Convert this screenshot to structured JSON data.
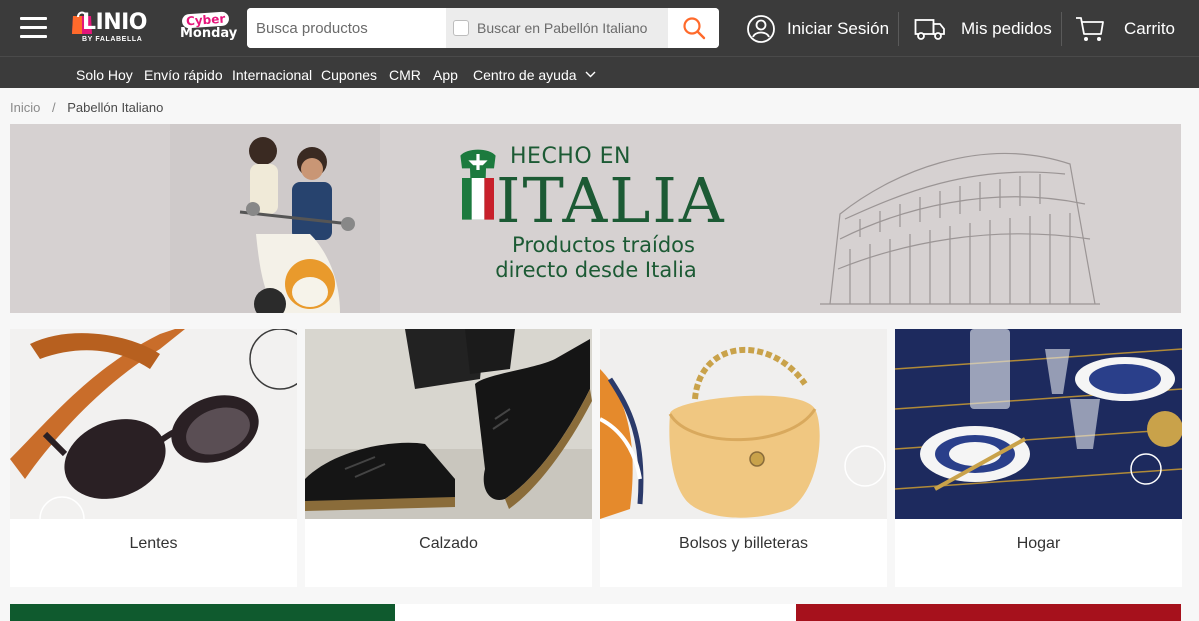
{
  "header": {
    "logo_text": "LINIO",
    "logo_subtext": "BY FALABELLA",
    "promo_line1": "Cyber",
    "promo_line2": "Monday",
    "search_placeholder": "Busca productos",
    "search_scope_label": "Buscar en Pabellón Italiano",
    "login_label": "Iniciar Sesión",
    "orders_label": "Mis pedidos",
    "cart_label": "Carrito"
  },
  "nav": {
    "items": [
      "Solo Hoy",
      "Envío rápido",
      "Internacional",
      "Cupones",
      "CMR",
      "App",
      "Centro de ayuda"
    ]
  },
  "breadcrumb": {
    "home": "Inicio",
    "separator": "/",
    "current": "Pabellón Italiano"
  },
  "banner": {
    "line1": "HECHO EN",
    "line2": "ITALIA",
    "line3": "Productos traídos",
    "line4": "directo desde Italia"
  },
  "categories": [
    {
      "label": "Lentes"
    },
    {
      "label": "Calzado"
    },
    {
      "label": "Bolsos y billeteras"
    },
    {
      "label": "Hogar"
    }
  ],
  "colors": {
    "header_bg": "#3b3b3b",
    "search_accent": "#ff6a2b",
    "italy_green": "#0f5a2e",
    "italy_red": "#a6111c",
    "brand_pink": "#e5157a"
  },
  "icons": {
    "menu": "hamburger-icon",
    "search": "magnifier-icon",
    "user": "user-icon",
    "orders": "truck-icon",
    "cart": "cart-icon"
  }
}
